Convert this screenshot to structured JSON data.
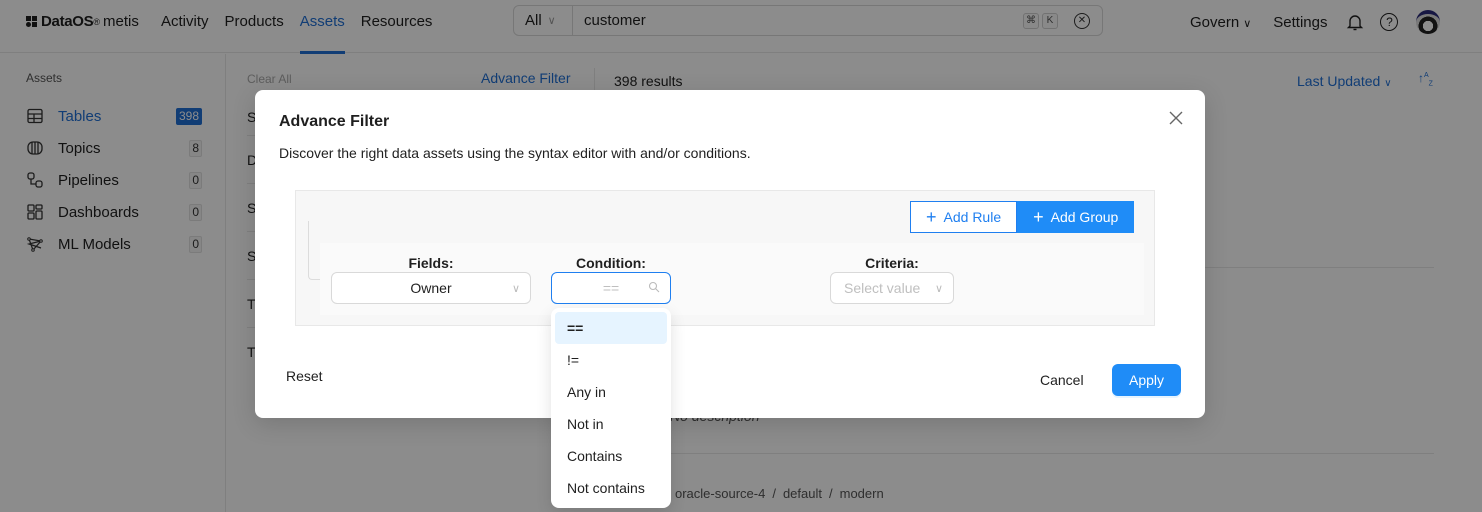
{
  "app": {
    "brand": "DataOS",
    "brand_mark": "®",
    "product": "metis"
  },
  "nav": {
    "items": [
      {
        "label": "Activity",
        "active": false
      },
      {
        "label": "Products",
        "active": false
      },
      {
        "label": "Assets",
        "active": true
      },
      {
        "label": "Resources",
        "active": false
      }
    ],
    "right": {
      "govern": "Govern",
      "settings": "Settings",
      "icons": [
        "bell-icon",
        "help-icon",
        "avatar"
      ]
    }
  },
  "search": {
    "scope": "All",
    "query": "customer",
    "shortcut_keys": [
      "⌘",
      "K"
    ]
  },
  "sidebar": {
    "heading": "Assets",
    "items": [
      {
        "label": "Tables",
        "count": "398",
        "icon": "table-icon",
        "active": true
      },
      {
        "label": "Topics",
        "count": "8",
        "icon": "topic-icon",
        "active": false
      },
      {
        "label": "Pipelines",
        "count": "0",
        "icon": "pipeline-icon",
        "active": false
      },
      {
        "label": "Dashboards",
        "count": "0",
        "icon": "dashboard-icon",
        "active": false
      },
      {
        "label": "ML Models",
        "count": "0",
        "icon": "ml-model-icon",
        "active": false
      }
    ]
  },
  "main": {
    "clear_all": "Clear All",
    "advance_filter_link": "Advance Filter",
    "results": "398 results",
    "sort_by": "Last Updated",
    "sort_direction_icon": "sort-ascending-az-icon",
    "filter_letters": [
      "S",
      "D",
      "S",
      "S",
      "T",
      "T"
    ],
    "bg_description": "No description",
    "bg_path": [
      "oracle-source-4",
      "default",
      "modern"
    ]
  },
  "modal": {
    "title": "Advance Filter",
    "subtitle": "Discover the right data assets using the syntax editor with and/or conditions.",
    "add_rule": "Add Rule",
    "add_group": "Add Group",
    "fields_label": "Fields:",
    "fields_value": "Owner",
    "condition_label": "Condition:",
    "condition_placeholder": "==",
    "criteria_label": "Criteria:",
    "criteria_placeholder": "Select value",
    "reset": "Reset",
    "cancel": "Cancel",
    "apply": "Apply"
  },
  "condition_dropdown": {
    "options": [
      "==",
      "!=",
      "Any in",
      "Not in",
      "Contains",
      "Not contains"
    ],
    "selected": "=="
  },
  "colors": {
    "accent": "#1f6fd6",
    "primary_button": "#1f8cf7",
    "selected_option_bg": "#e6f4ff"
  }
}
